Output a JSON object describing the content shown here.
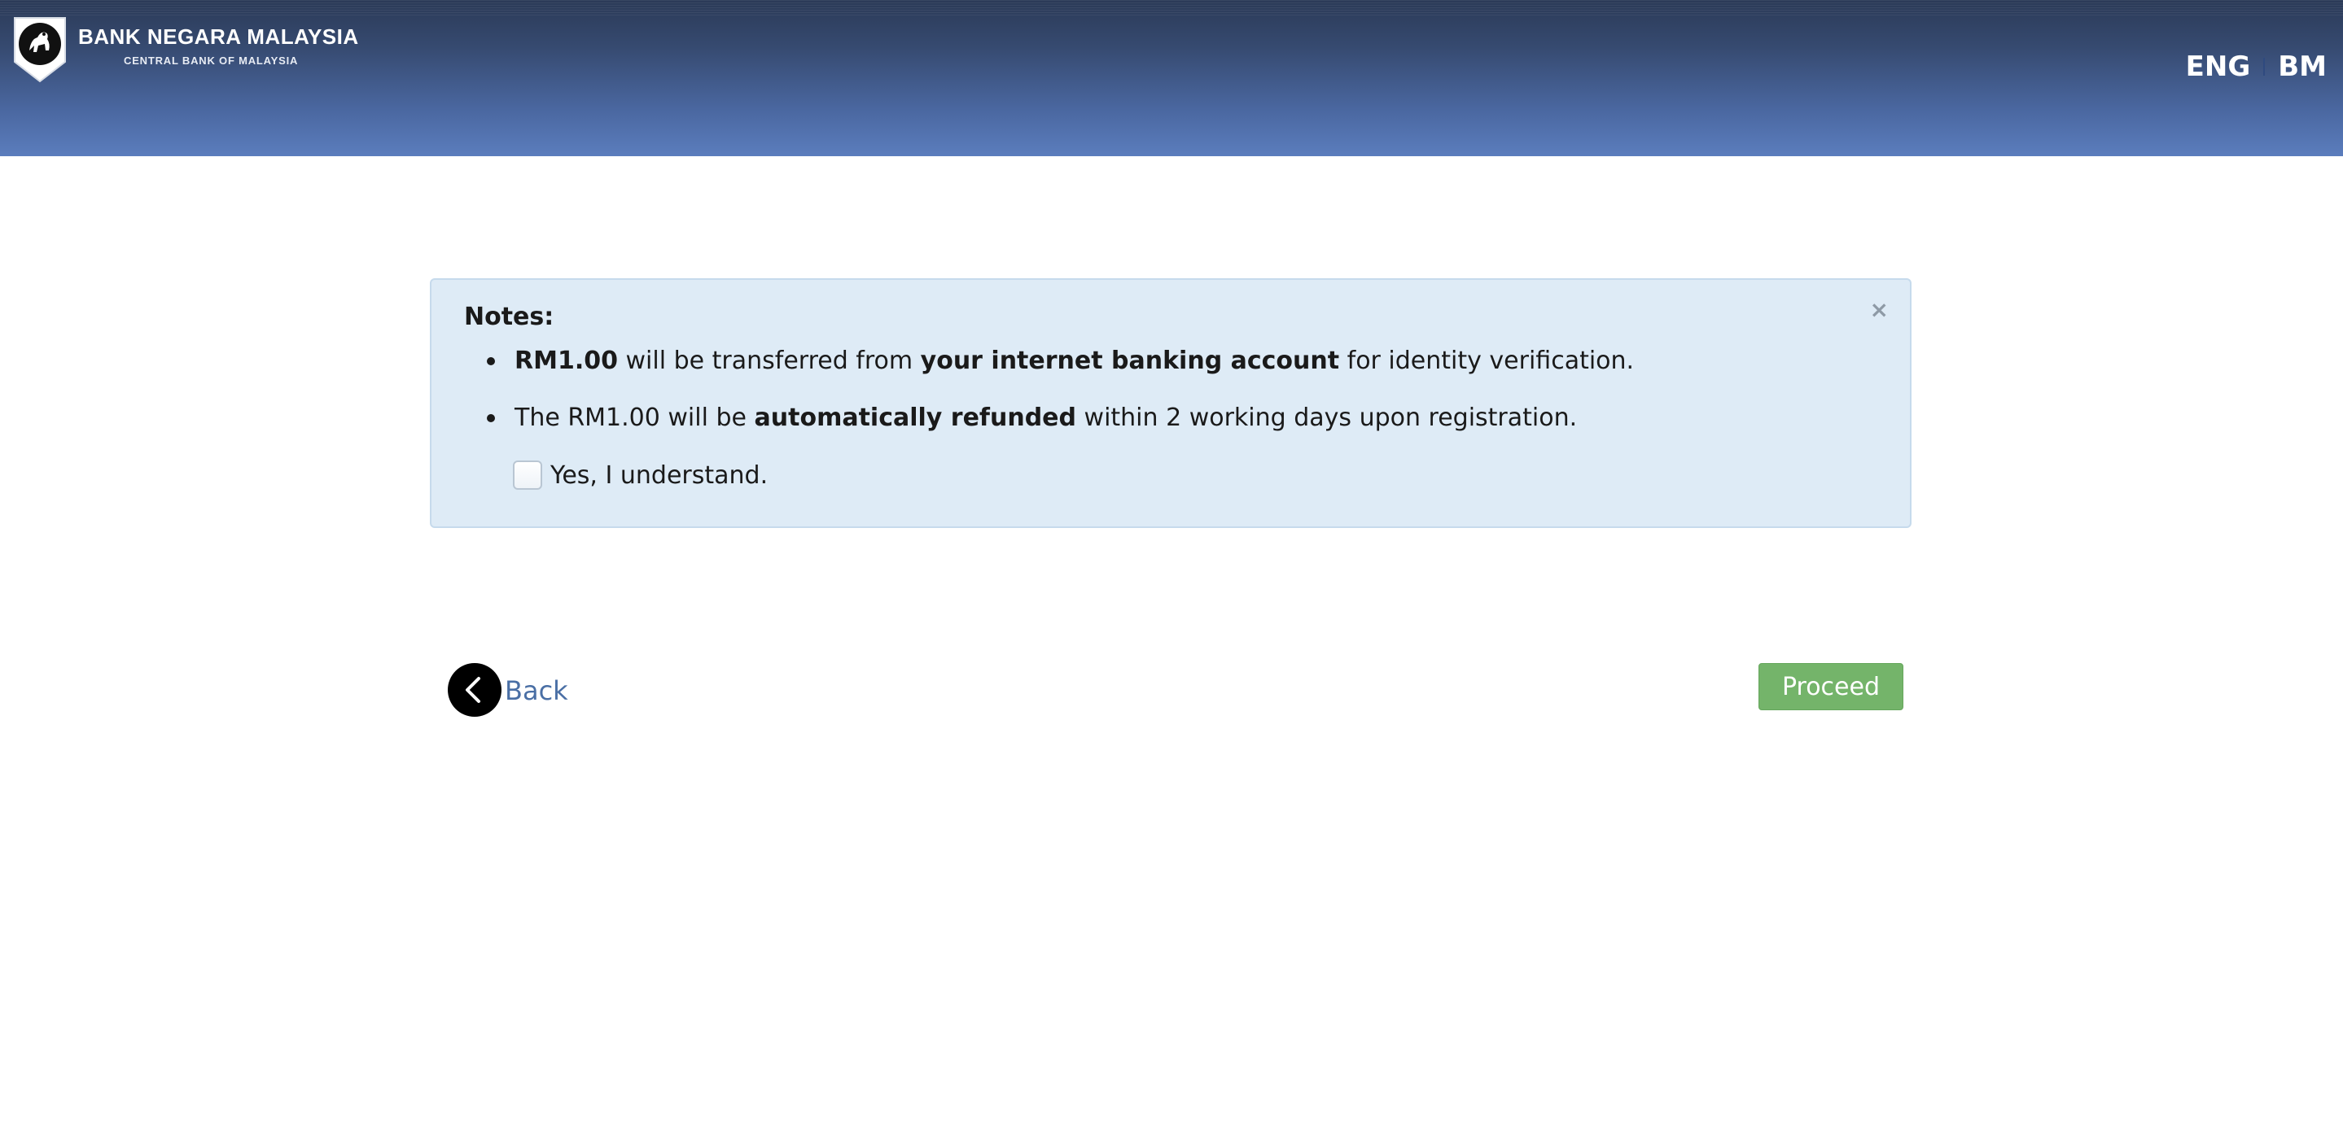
{
  "header": {
    "brand_title": "BANK NEGARA MALAYSIA",
    "brand_subtitle": "CENTRAL BANK OF MALAYSIA",
    "logo_icon": "bnm-crest-icon",
    "languages": [
      "ENG",
      "BM"
    ]
  },
  "notes": {
    "title": "Notes:",
    "close_glyph": "×",
    "item1": {
      "part1": "RM1.00",
      "part2": " will be transferred from ",
      "part3": "your internet banking account",
      "part4": " for identity verification."
    },
    "item2": {
      "part1": "The RM1.00 will be ",
      "part2": "automatically refunded",
      "part3": " within 2 working days upon registration."
    },
    "checkbox_label": "Yes, I understand.",
    "checkbox_checked": false
  },
  "actions": {
    "back_label": "Back",
    "proceed_label": "Proceed"
  },
  "colors": {
    "header_top": "#2b3a57",
    "header_bottom": "#5b7dbd",
    "notes_bg": "#deebf6",
    "proceed_bg": "#74b46a",
    "link": "#4a6fa5"
  }
}
